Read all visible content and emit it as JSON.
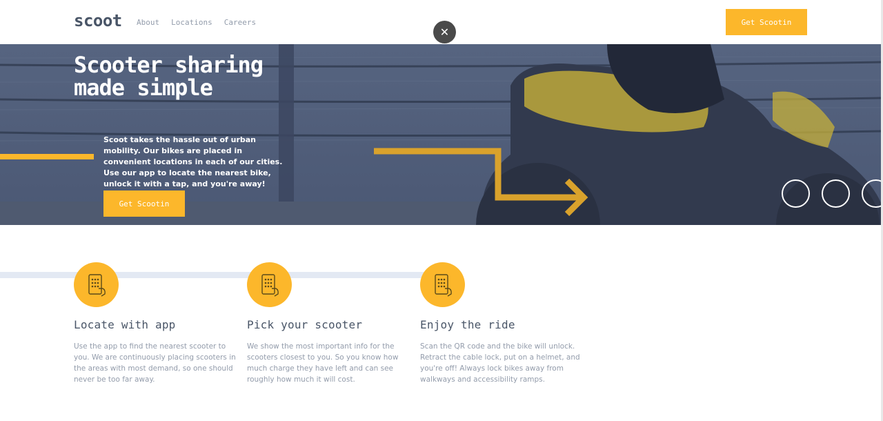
{
  "header": {
    "logo": "scoot",
    "nav": [
      "About",
      "Locations",
      "Careers"
    ],
    "cta_label": "Get Scootin"
  },
  "modal": {
    "close_icon": "close-icon"
  },
  "hero": {
    "title_line1": "Scooter sharing",
    "title_line2": "made simple",
    "description": "Scoot takes the hassle out of urban mobility. Our bikes are placed in convenient locations in each of our cities. Use our app to locate the nearest bike, unlock it with a tap, and you're away!",
    "cta_label": "Get Scootin"
  },
  "features": [
    {
      "icon": "phone-tap-icon",
      "title": "Locate with app",
      "text": "Use the app to find the nearest scooter to you. We are continuously placing scooters in the areas with most demand, so one should never be too far away."
    },
    {
      "icon": "phone-tap-icon",
      "title": "Pick your scooter",
      "text": "We show the most important info for the scooters closest to you. So you know how much charge they have left and can see roughly how much it will cost."
    },
    {
      "icon": "phone-tap-icon",
      "title": "Enjoy the ride",
      "text": "Scan the QR code and the bike will unlock. Retract the cable lock, put on a helmet, and you're off! Always lock bikes away from walkways and accessibility ramps."
    }
  ],
  "colors": {
    "accent": "#fcb72b",
    "dark": "#495567",
    "muted": "#939cab",
    "hero_overlay": "#4a5873"
  }
}
